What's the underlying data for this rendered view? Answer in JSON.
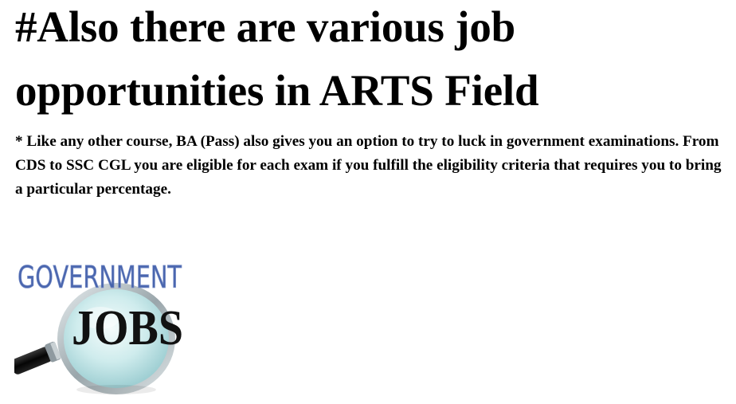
{
  "heading": {
    "line1": "#Also there are various job",
    "line2": "opportunities in ARTS Field"
  },
  "paragraph": {
    "text": "* Like any other course, BA (Pass) also gives you an option to try to luck in government examinations. From CDS to SSC CGL you are eligible for each exam if you fulfill the eligibility criteria that requires you to bring a particular percentage."
  },
  "image": {
    "top_word": "GOVERNMENT",
    "main_word": "JOBS",
    "icon": "magnifying-glass-icon",
    "colors": {
      "top_word": "#3b5aa8",
      "lens_tint": "#bfe3e6",
      "handle": "#111111",
      "main_word": "#111111"
    }
  }
}
